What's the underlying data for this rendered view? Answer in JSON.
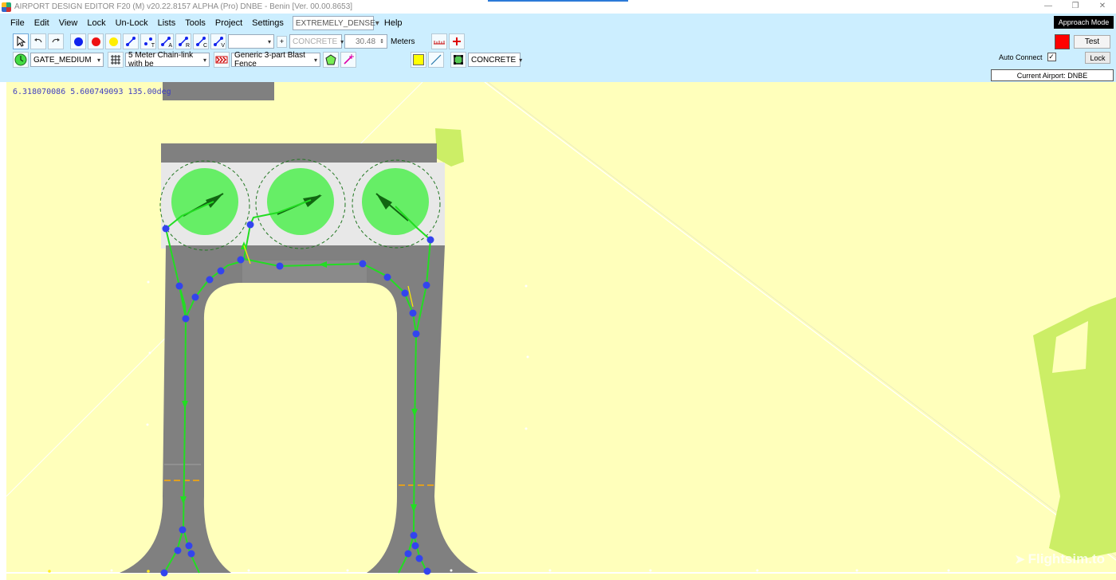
{
  "window": {
    "title": "AIRPORT DESIGN EDITOR F20 (M)  v20.22.8157 ALPHA (Pro)  DNBE - Benin [Ver. 00.00.8653]",
    "min_icon": "—",
    "restore_icon": "❐",
    "close_icon": "✕"
  },
  "menu": {
    "items": [
      "File",
      "Edit",
      "View",
      "Lock",
      "Un-Lock",
      "Lists",
      "Tools",
      "Project",
      "Settings"
    ],
    "density": "EXTREMELY_DENSE",
    "help": "Help"
  },
  "toolbar": {
    "surface_combo": "CONCRETE",
    "width_value": "30.48",
    "width_unit": "Meters",
    "plus_glyph": "+",
    "gate_combo": "GATE_MEDIUM",
    "fence_combo": "5 Meter Chain-link with be",
    "blast_fence_combo": "Generic 3-part Blast Fence",
    "apron_surface_combo": "CONCRETE",
    "node_tool_letters": [
      "T",
      "A",
      "R",
      "C",
      "V"
    ]
  },
  "right_panel": {
    "approach_mode": "Approach Mode",
    "test_label": "Test",
    "auto_connect_label": "Auto Connect",
    "auto_connect_checked": true,
    "lock_label": "Lock",
    "current_airport": "Current Airport: DNBE",
    "swatch_color": "#ff0000"
  },
  "map": {
    "coordinates": "6.318070086  5.600749093  135.00deg",
    "watermark": "Flightsim.to",
    "gate_count": 3
  },
  "colors": {
    "background": "#ffffbb",
    "toolbar_bg": "#cceeff",
    "pavement": "#808080",
    "apron": "#e8e8e8",
    "taxi_path": "#22dd22",
    "taxi_node": "#3344ee",
    "gate_circle": "#66ee66",
    "grass_patch": "#ccee66"
  }
}
